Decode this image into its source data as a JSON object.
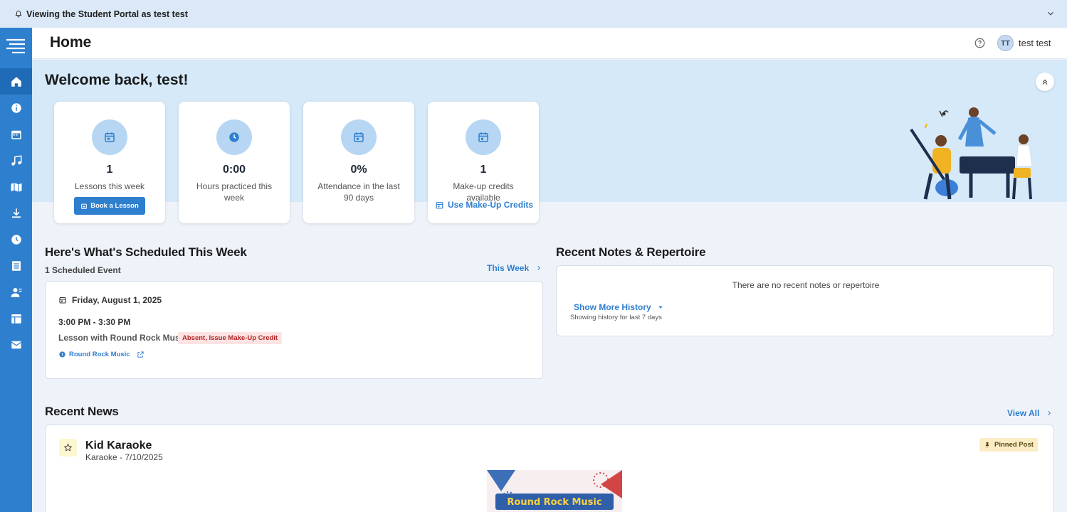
{
  "banner": {
    "text": "Viewing the Student Portal as test test"
  },
  "header": {
    "title": "Home",
    "avatar_initials": "TT",
    "user_name": "test test"
  },
  "sidebar": {
    "items": [
      {
        "icon": "home-icon",
        "active": true
      },
      {
        "icon": "info-icon"
      },
      {
        "icon": "calendar-icon"
      },
      {
        "icon": "music-note-icon"
      },
      {
        "icon": "map-icon"
      },
      {
        "icon": "download-icon"
      },
      {
        "icon": "clock-icon"
      },
      {
        "icon": "document-list-icon"
      },
      {
        "icon": "person-icon"
      },
      {
        "icon": "store-icon"
      },
      {
        "icon": "mail-icon"
      }
    ]
  },
  "hero": {
    "welcome": "Welcome back, test!"
  },
  "stats": [
    {
      "icon": "calendar-icon",
      "value": "1",
      "label": "Lessons this week",
      "action": "Book a Lesson"
    },
    {
      "icon": "clock-icon",
      "value": "0:00",
      "label": "Hours practiced this week"
    },
    {
      "icon": "calendar-icon",
      "value": "0%",
      "label": "Attendance in the last 90 days"
    },
    {
      "icon": "calendar-icon",
      "value": "1",
      "label": "Make-up credits available",
      "action": "Use Make-Up Credits"
    }
  ],
  "schedule": {
    "heading": "Here's What's Scheduled This Week",
    "count": "1 Scheduled Event",
    "period_link": "This Week",
    "event": {
      "date": "Friday, August 1, 2025",
      "time": "3:00 PM - 3:30 PM",
      "title": "Lesson with Round Rock Music",
      "status": "Absent, Issue Make-Up Credit",
      "location": "Round Rock Music"
    }
  },
  "notes": {
    "heading": "Recent Notes & Repertoire",
    "empty": "There are no recent notes or repertoire",
    "more": "Show More History",
    "hint": "Showing history for last 7 days"
  },
  "news": {
    "heading": "Recent News",
    "view_all": "View All",
    "post": {
      "title": "Kid Karaoke",
      "subtitle": "Karaoke - 7/10/2025",
      "badge": "Pinned Post",
      "image_text": "Round Rock Music"
    }
  },
  "colors": {
    "primary": "#2f7fcf",
    "sidebar": "#2f7fcf",
    "hero_bg": "#d5e9f9",
    "badge_red": "#fde3e3",
    "pinned_bg": "#fbecc5"
  }
}
